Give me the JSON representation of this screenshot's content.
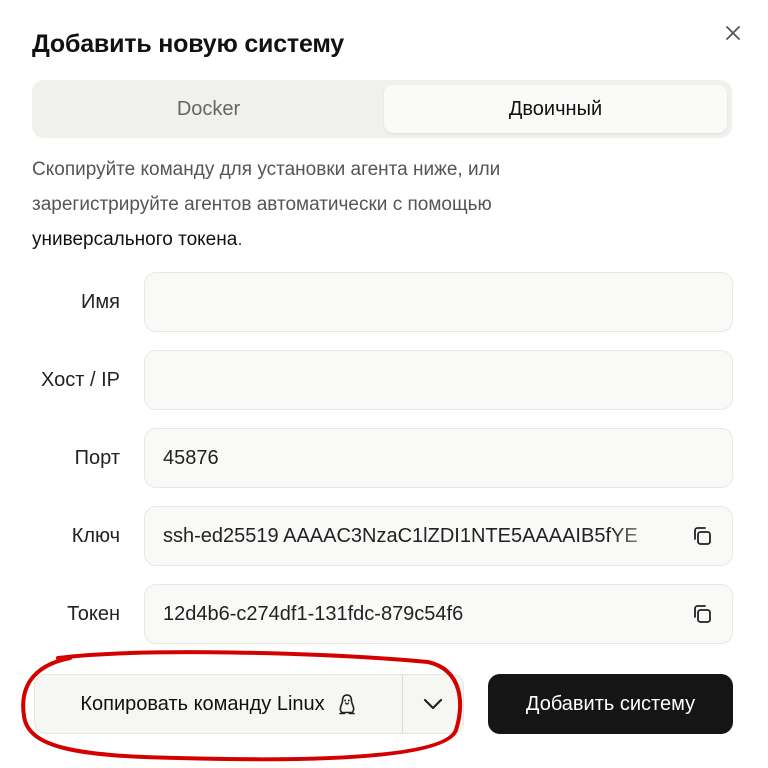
{
  "dialog": {
    "title": "Добавить новую систему",
    "close_icon": "close-icon"
  },
  "tabs": [
    {
      "label": "Docker",
      "active": false
    },
    {
      "label": "Двоичный",
      "active": true
    }
  ],
  "description": {
    "line1": "Скопируйте команду для установки агента ниже, или",
    "line2": "зарегистрируйте агентов автоматически с помощью",
    "link_text": "универсального токена",
    "end": "."
  },
  "form": {
    "name": {
      "label": "Имя",
      "value": ""
    },
    "host": {
      "label": "Хост / IP",
      "value": ""
    },
    "port": {
      "label": "Порт",
      "value": "45876"
    },
    "key": {
      "label": "Ключ",
      "value": "ssh-ed25519 AAAAC3NzaC1lZDI1NTE5AAAAIB5fYE"
    },
    "token": {
      "label": "Токен",
      "value": "12d4b6-c274df1-131fdc-879c54f6"
    }
  },
  "actions": {
    "copy_command_label": "Копировать команду Linux",
    "copy_command_icon": "linux-tux-icon",
    "dropdown_icon": "chevron-down-icon",
    "submit_label": "Добавить систему"
  },
  "colors": {
    "primary_button": "#151515",
    "annotation": "#d40000"
  }
}
